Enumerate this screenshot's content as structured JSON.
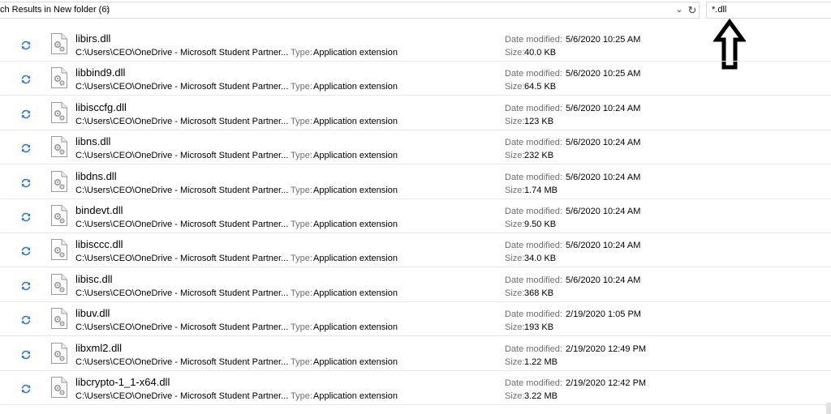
{
  "address_bar": {
    "breadcrumb": "ch Results in New folder (6)",
    "separator": "›",
    "dropdown_icon": "chevron-down-icon",
    "refresh_icon": "refresh-icon"
  },
  "search": {
    "value": "*.dll"
  },
  "labels": {
    "type": "Type:",
    "date_modified": "Date modified:",
    "size": "Size:"
  },
  "colors": {
    "arrow": "#000000",
    "sync": "#2b78d6",
    "divider": "#e6e6e6"
  },
  "files": [
    {
      "name": "libirs.dll",
      "path": "C:\\Users\\CEO\\OneDrive - Microsoft Student Partner...",
      "type": "Application extension",
      "date": "5/6/2020 10:25 AM",
      "size": "40.0 KB"
    },
    {
      "name": "libbind9.dll",
      "path": "C:\\Users\\CEO\\OneDrive - Microsoft Student Partner...",
      "type": "Application extension",
      "date": "5/6/2020 10:25 AM",
      "size": "64.5 KB"
    },
    {
      "name": "libisccfg.dll",
      "path": "C:\\Users\\CEO\\OneDrive - Microsoft Student Partner...",
      "type": "Application extension",
      "date": "5/6/2020 10:24 AM",
      "size": "123 KB"
    },
    {
      "name": "libns.dll",
      "path": "C:\\Users\\CEO\\OneDrive - Microsoft Student Partner...",
      "type": "Application extension",
      "date": "5/6/2020 10:24 AM",
      "size": "232 KB"
    },
    {
      "name": "libdns.dll",
      "path": "C:\\Users\\CEO\\OneDrive - Microsoft Student Partner...",
      "type": "Application extension",
      "date": "5/6/2020 10:24 AM",
      "size": "1.74 MB"
    },
    {
      "name": "bindevt.dll",
      "path": "C:\\Users\\CEO\\OneDrive - Microsoft Student Partner...",
      "type": "Application extension",
      "date": "5/6/2020 10:24 AM",
      "size": "9.50 KB"
    },
    {
      "name": "libisccc.dll",
      "path": "C:\\Users\\CEO\\OneDrive - Microsoft Student Partner...",
      "type": "Application extension",
      "date": "5/6/2020 10:24 AM",
      "size": "34.0 KB"
    },
    {
      "name": "libisc.dll",
      "path": "C:\\Users\\CEO\\OneDrive - Microsoft Student Partner...",
      "type": "Application extension",
      "date": "5/6/2020 10:24 AM",
      "size": "368 KB"
    },
    {
      "name": "libuv.dll",
      "path": "C:\\Users\\CEO\\OneDrive - Microsoft Student Partner...",
      "type": "Application extension",
      "date": "2/19/2020 1:05 PM",
      "size": "193 KB"
    },
    {
      "name": "libxml2.dll",
      "path": "C:\\Users\\CEO\\OneDrive - Microsoft Student Partner...",
      "type": "Application extension",
      "date": "2/19/2020 12:49 PM",
      "size": "1.22 MB"
    },
    {
      "name": "libcrypto-1_1-x64.dll",
      "path": "C:\\Users\\CEO\\OneDrive - Microsoft Student Partner...",
      "type": "Application extension",
      "date": "2/19/2020 12:42 PM",
      "size": "3.22 MB"
    }
  ]
}
